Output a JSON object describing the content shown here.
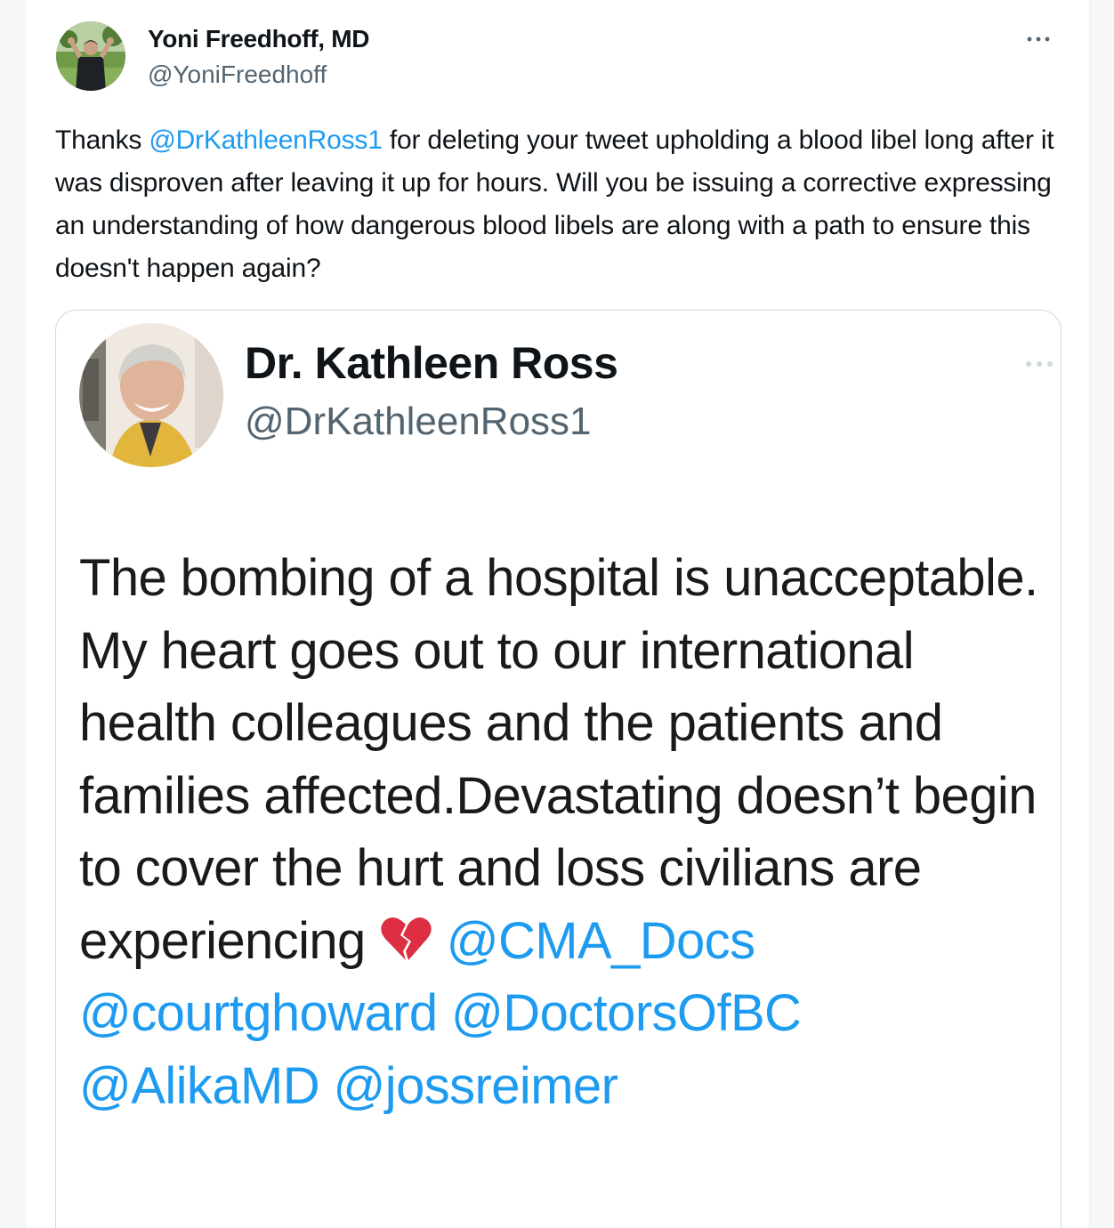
{
  "tweet": {
    "author": {
      "name": "Yoni Freedhoff, MD",
      "handle": "@YoniFreedhoff"
    },
    "more_icon": "more-horizontal-icon",
    "text_parts": {
      "p1": "Thanks ",
      "mention1": "@DrKathleenRoss1",
      "p2": " for deleting your tweet upholding a blood libel long after it was disproven after leaving it up for hours. Will you be issuing a corrective expressing an understanding of how dangerous blood libels are along with a path to ensure this doesn't happen again?"
    }
  },
  "quoted": {
    "author": {
      "name": "Dr. Kathleen Ross",
      "handle": "@DrKathleenRoss1"
    },
    "more_icon": "more-horizontal-icon",
    "text_parts": {
      "body": "The bombing of a hospital is unacceptable. My heart goes out to our international health colleagues and the patients and families affected.Devastating doesn’t begin to cover the hurt and loss civilians are experiencing ",
      "emoji": "broken-heart-icon",
      "mention1": "@CMA_Docs",
      "mention2": "@courtghoward",
      "mention3": "@DoctorsOfBC",
      "mention4": "@AlikaMD",
      "mention5": "@jossreimer"
    }
  },
  "colors": {
    "link": "#1d9bf0",
    "text": "#0f1419",
    "secondary": "#536471",
    "border": "#cfd9de"
  }
}
